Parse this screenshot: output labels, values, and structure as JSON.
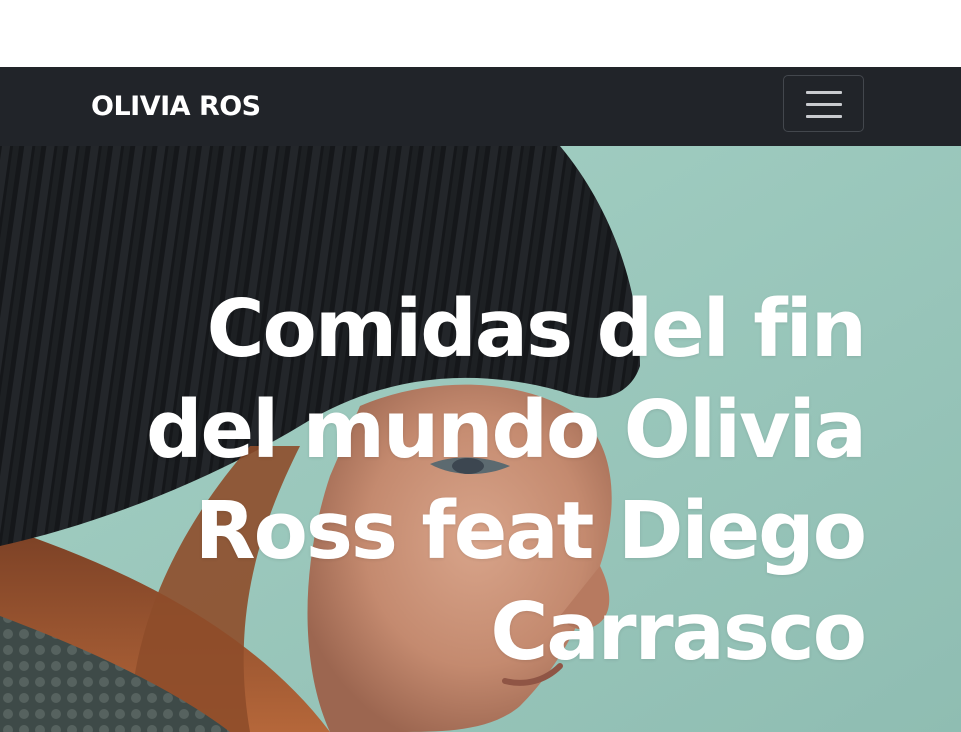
{
  "navbar": {
    "brand": "OLIVIA ROS",
    "toggler_icon": "hamburger-menu-icon"
  },
  "hero": {
    "title": "Comidas del fin del mundo Olivia Ross feat Diego Carrasco",
    "image": "woman-in-black-beanie-photo"
  },
  "colors": {
    "navbar_bg": "#212429",
    "hero_text": "#ffffff",
    "hero_sky": "#9ac8bc"
  }
}
